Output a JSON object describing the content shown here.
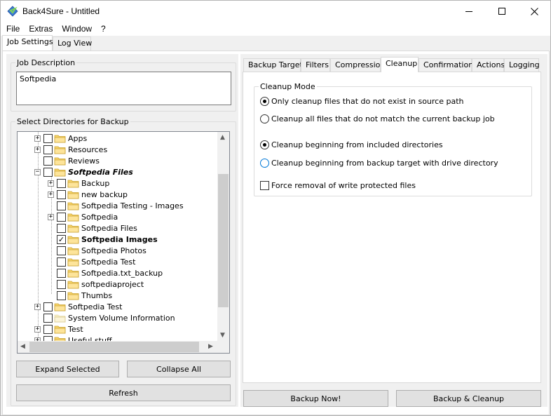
{
  "window": {
    "title": "Back4Sure - Untitled"
  },
  "menu": [
    "File",
    "Extras",
    "Window",
    "?"
  ],
  "top_tabs": [
    "Job Settings",
    "Log View"
  ],
  "job_description": {
    "label": "Job Description",
    "value": "Softpedia"
  },
  "directories": {
    "label": "Select Directories for Backup",
    "items": [
      {
        "label": "Apps",
        "expander": "+",
        "checked": false,
        "bold": false
      },
      {
        "label": "Resources",
        "expander": "+",
        "checked": false,
        "bold": false
      },
      {
        "label": "Reviews",
        "expander": "",
        "checked": false,
        "bold": false
      },
      {
        "label": "Softpedia Files",
        "expander": "−",
        "checked": false,
        "bold": true
      },
      {
        "label": "Backup",
        "expander": "+",
        "checked": false,
        "bold": false
      },
      {
        "label": "new backup",
        "expander": "+",
        "checked": false,
        "bold": false
      },
      {
        "label": "Softpedia Testing - Images",
        "expander": "",
        "checked": false,
        "bold": false
      },
      {
        "label": "Softpedia",
        "expander": "+",
        "checked": false,
        "bold": false
      },
      {
        "label": "Softpedia Files",
        "expander": "",
        "checked": false,
        "bold": false
      },
      {
        "label": "Softpedia Images",
        "expander": "",
        "checked": true,
        "bold": true
      },
      {
        "label": "Softpedia Photos",
        "expander": "",
        "checked": false,
        "bold": false
      },
      {
        "label": "Softpedia Test",
        "expander": "",
        "checked": false,
        "bold": false
      },
      {
        "label": "Softpedia.txt_backup",
        "expander": "",
        "checked": false,
        "bold": false
      },
      {
        "label": "softpediaproject",
        "expander": "",
        "checked": false,
        "bold": false
      },
      {
        "label": "Thumbs",
        "expander": "",
        "checked": false,
        "bold": false
      },
      {
        "label": "Softpedia Test",
        "expander": "+",
        "checked": false,
        "bold": false
      },
      {
        "label": "System Volume Information",
        "expander": "",
        "checked": false,
        "bold": false
      },
      {
        "label": "Test",
        "expander": "+",
        "checked": false,
        "bold": false
      },
      {
        "label": "Useful stuff",
        "expander": "+",
        "checked": false,
        "bold": false
      }
    ]
  },
  "buttons": {
    "expand_selected": "Expand Selected",
    "collapse_all": "Collapse All",
    "refresh": "Refresh",
    "backup_now": "Backup Now!",
    "backup_cleanup": "Backup & Cleanup"
  },
  "right_tabs": [
    "Backup Target",
    "Filters",
    "Compression",
    "Cleanup",
    "Confirmations",
    "Actions",
    "Logging"
  ],
  "cleanup": {
    "group_label": "Cleanup Mode",
    "option1": "Only cleanup files that do not exist in source path",
    "option2": "Cleanup all files that do not match the current backup job",
    "option3": "Cleanup beginning from included directories",
    "option4": "Cleanup beginning from backup target with drive directory",
    "force_removal": "Force removal of write protected files"
  }
}
